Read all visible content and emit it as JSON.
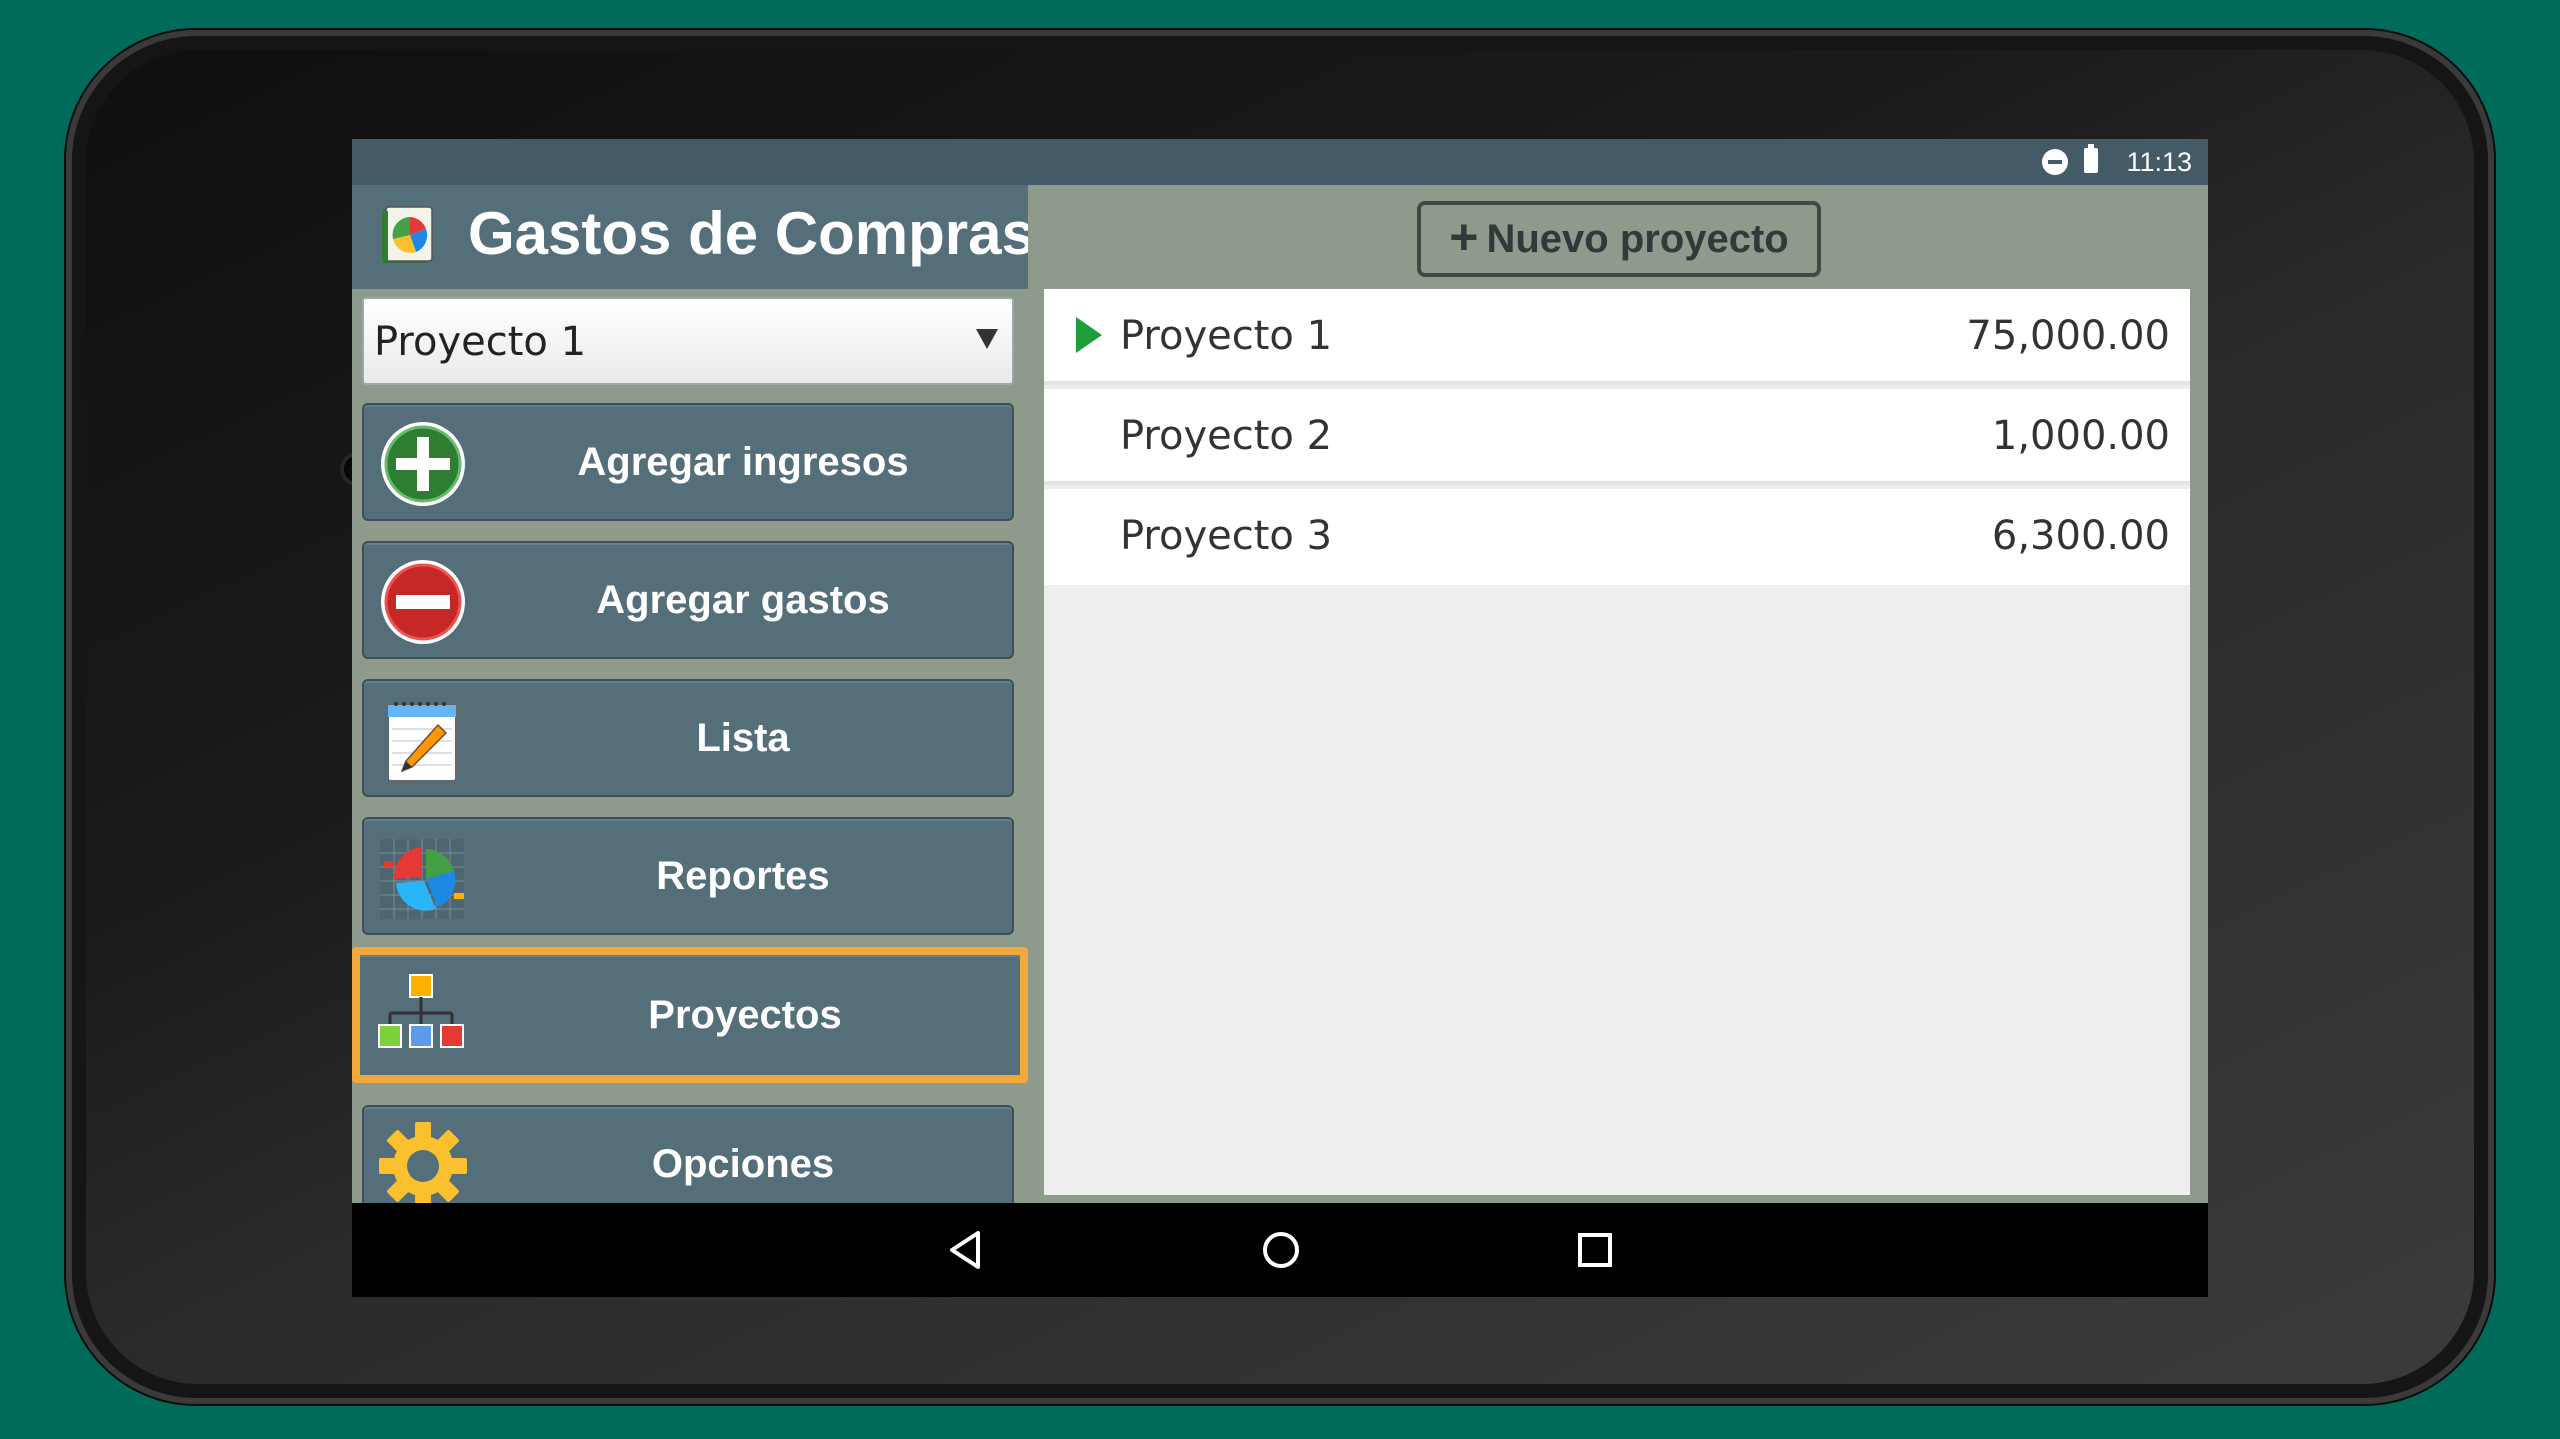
{
  "status_bar": {
    "time": "11:13",
    "icons": [
      "do-not-disturb-icon",
      "battery-icon"
    ]
  },
  "app": {
    "title": "Gastos de Compras",
    "logo": "app-logo-icon"
  },
  "project_selector": {
    "value": "Proyecto 1"
  },
  "menu": {
    "items": [
      {
        "label": "Agregar ingresos",
        "icon": "add-income-icon"
      },
      {
        "label": "Agregar gastos",
        "icon": "add-expense-icon"
      },
      {
        "label": "Lista",
        "icon": "notepad-pencil-icon"
      },
      {
        "label": "Reportes",
        "icon": "pie-chart-report-icon"
      },
      {
        "label": "Proyectos",
        "icon": "hierarchy-icon",
        "active": true
      },
      {
        "label": "Opciones",
        "icon": "gear-icon"
      }
    ]
  },
  "new_project_button": {
    "label": "Nuevo proyecto"
  },
  "projects": [
    {
      "name": "Proyecto 1",
      "amount": "75,000.00",
      "selected": true
    },
    {
      "name": "Proyecto 2",
      "amount": "1,000.00"
    },
    {
      "name": "Proyecto 3",
      "amount": "6,300.00"
    }
  ],
  "nav_bar": {
    "buttons": [
      "back-icon",
      "home-icon",
      "recent-apps-icon"
    ]
  },
  "colors": {
    "background": "#006b5b",
    "header": "#546e7a",
    "panel": "#8d9a8c",
    "active_border": "#f2a93b",
    "selected_marker": "#1e9e3a"
  }
}
